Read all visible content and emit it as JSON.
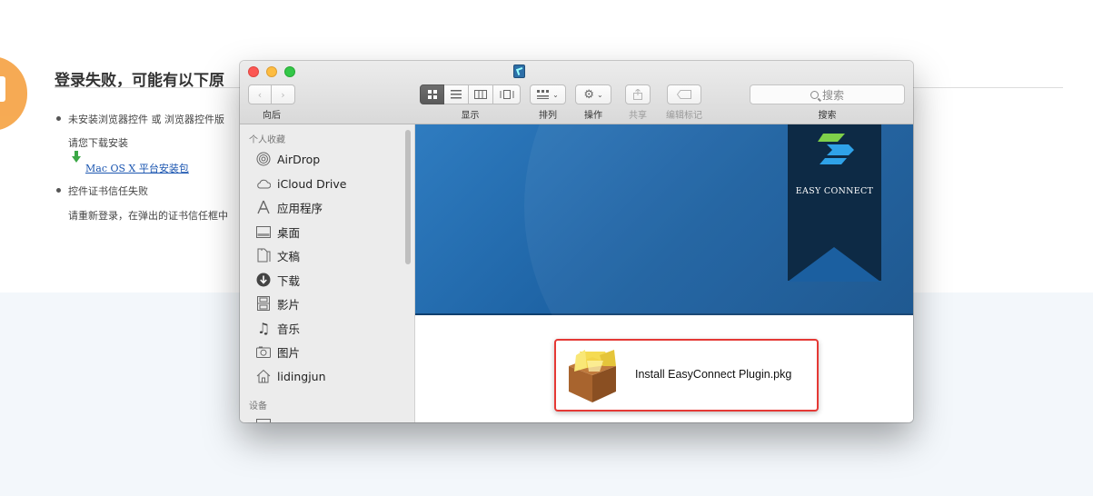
{
  "background_page": {
    "title": "登录失败，可能有以下原",
    "items": [
      {
        "text": "未安装浏览器控件 或 浏览器控件版",
        "sub": "请您下载安装"
      },
      {
        "text": "控件证书信任失败",
        "sub": "请重新登录，在弹出的证书信任框中"
      }
    ],
    "download_link": "Mac OS X 平台安装包"
  },
  "finder": {
    "toolbar": {
      "nav_label": "向后",
      "view_label": "显示",
      "arrange_label": "排列",
      "action_label": "操作",
      "share_label": "共享",
      "tags_label": "编辑标记",
      "search_label": "搜索",
      "search_placeholder": "搜索"
    },
    "sidebar": {
      "favorites_header": "个人收藏",
      "items": [
        {
          "label": "AirDrop",
          "icon": "airdrop-icon"
        },
        {
          "label": "iCloud Drive",
          "icon": "cloud-icon"
        },
        {
          "label": "应用程序",
          "icon": "applications-icon"
        },
        {
          "label": "桌面",
          "icon": "desktop-icon"
        },
        {
          "label": "文稿",
          "icon": "documents-icon"
        },
        {
          "label": "下载",
          "icon": "downloads-icon"
        },
        {
          "label": "影片",
          "icon": "movies-icon"
        },
        {
          "label": "音乐",
          "icon": "music-icon"
        },
        {
          "label": "图片",
          "icon": "pictures-icon"
        },
        {
          "label": "lidingjun",
          "icon": "home-icon"
        }
      ],
      "devices_header": "设备"
    },
    "content": {
      "brand_text": "EASY CONNECT",
      "file_name": "Install EasyConnect Plugin.pkg"
    }
  },
  "colors": {
    "highlight": "#e53935",
    "banner": "#1b5fa0",
    "ribbon": "#0d2a45",
    "link": "#1a55b0"
  }
}
